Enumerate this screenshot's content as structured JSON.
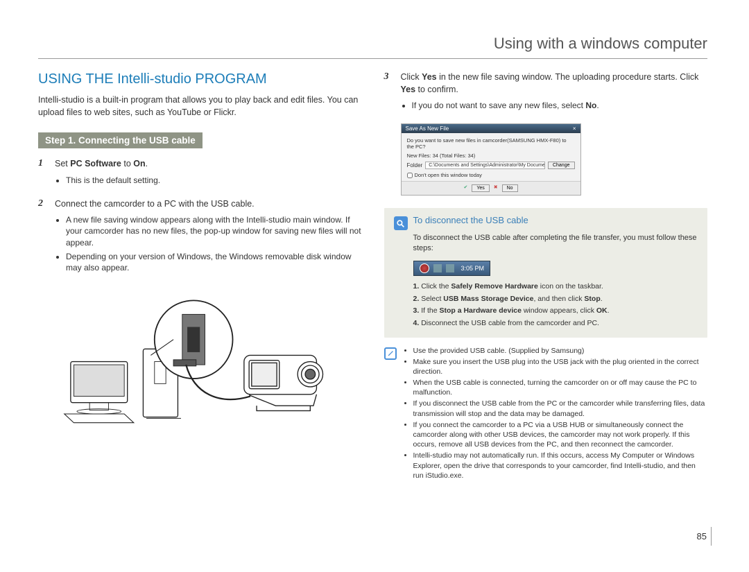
{
  "header": {
    "title": "Using with a windows computer"
  },
  "left": {
    "section_title": "USING THE Intelli-studio PROGRAM",
    "intro": "Intelli-studio is a built-in program that allows you to play back and edit files. You can upload files to web sites, such as YouTube or Flickr.",
    "step_bar": "Step 1. Connecting the USB cable",
    "steps": {
      "s1": {
        "num": "1",
        "text_pre": "Set ",
        "bold1": "PC Software",
        "mid": " to ",
        "bold2": "On",
        "post": ".",
        "sub1": "This is the default setting."
      },
      "s2": {
        "num": "2",
        "text": "Connect the camcorder to a PC with the USB cable.",
        "sub1": "A new file saving window appears along with the Intelli-studio main window. If your camcorder has no new files, the pop-up window for saving new files will not appear.",
        "sub2": "Depending on your version of Windows, the Windows removable disk window may also appear."
      }
    }
  },
  "right": {
    "s3": {
      "num": "3",
      "text_pre": "Click ",
      "bold1": "Yes",
      "mid": " in the new file saving window. The uploading procedure starts. Click ",
      "bold2": "Yes",
      "post": " to confirm.",
      "sub1_pre": "If you do not want to save any new files, select ",
      "sub1_bold": "No",
      "sub1_post": "."
    },
    "dialog": {
      "title": "Save As New File",
      "close": "×",
      "line1": "Do you want to save new files in camcorder(SAMSUNG HMX-F80) to the PC?",
      "line2": "New Files: 34 (Total Files: 34)",
      "folder_label": "Folder",
      "folder_path": "C:\\Documents and Settings\\Administrator\\My Documents\\Intelli-s",
      "change": "Change",
      "check": "Don't open this window today",
      "yes": "Yes",
      "no": "No"
    },
    "disconnect": {
      "title": "To disconnect the USB cable",
      "desc": "To disconnect the USB cable after completing the file transfer, you must follow these steps:",
      "taskbar_time": "3:05 PM",
      "steps": {
        "s1": {
          "n": "1.",
          "pre": "Click the ",
          "b": "Safely Remove Hardware",
          "post": " icon on the taskbar."
        },
        "s2": {
          "n": "2.",
          "pre": "Select ",
          "b": "USB Mass Storage Device",
          "mid": ", and then click ",
          "b2": "Stop",
          "post": "."
        },
        "s3": {
          "n": "3.",
          "pre": "If the ",
          "b": "Stop a Hardware device",
          "mid": " window appears, click ",
          "b2": "OK",
          "post": "."
        },
        "s4": {
          "n": "4.",
          "t": "Disconnect the USB cable from the camcorder and PC."
        }
      }
    },
    "notes": {
      "n1": "Use the provided USB cable. (Supplied by Samsung)",
      "n2": "Make sure you insert the USB plug into the USB jack with the plug oriented in the correct direction.",
      "n3": "When the USB cable is connected, turning the camcorder on or off may cause the PC to malfunction.",
      "n4": "If you disconnect the USB cable from the PC or the camcorder while transferring files, data transmission will stop and the data may be damaged.",
      "n5": "If you connect the camcorder to a PC via a USB HUB or simultaneously connect the camcorder along with other USB devices, the camcorder may not work properly. If this occurs, remove all USB devices from the PC, and then reconnect the camcorder.",
      "n6": "Intelli-studio may not automatically run. If this occurs, access My Computer or Windows Explorer, open the drive that corresponds to your camcorder, find Intelli-studio, and then run iStudio.exe."
    }
  },
  "page_number": "85"
}
